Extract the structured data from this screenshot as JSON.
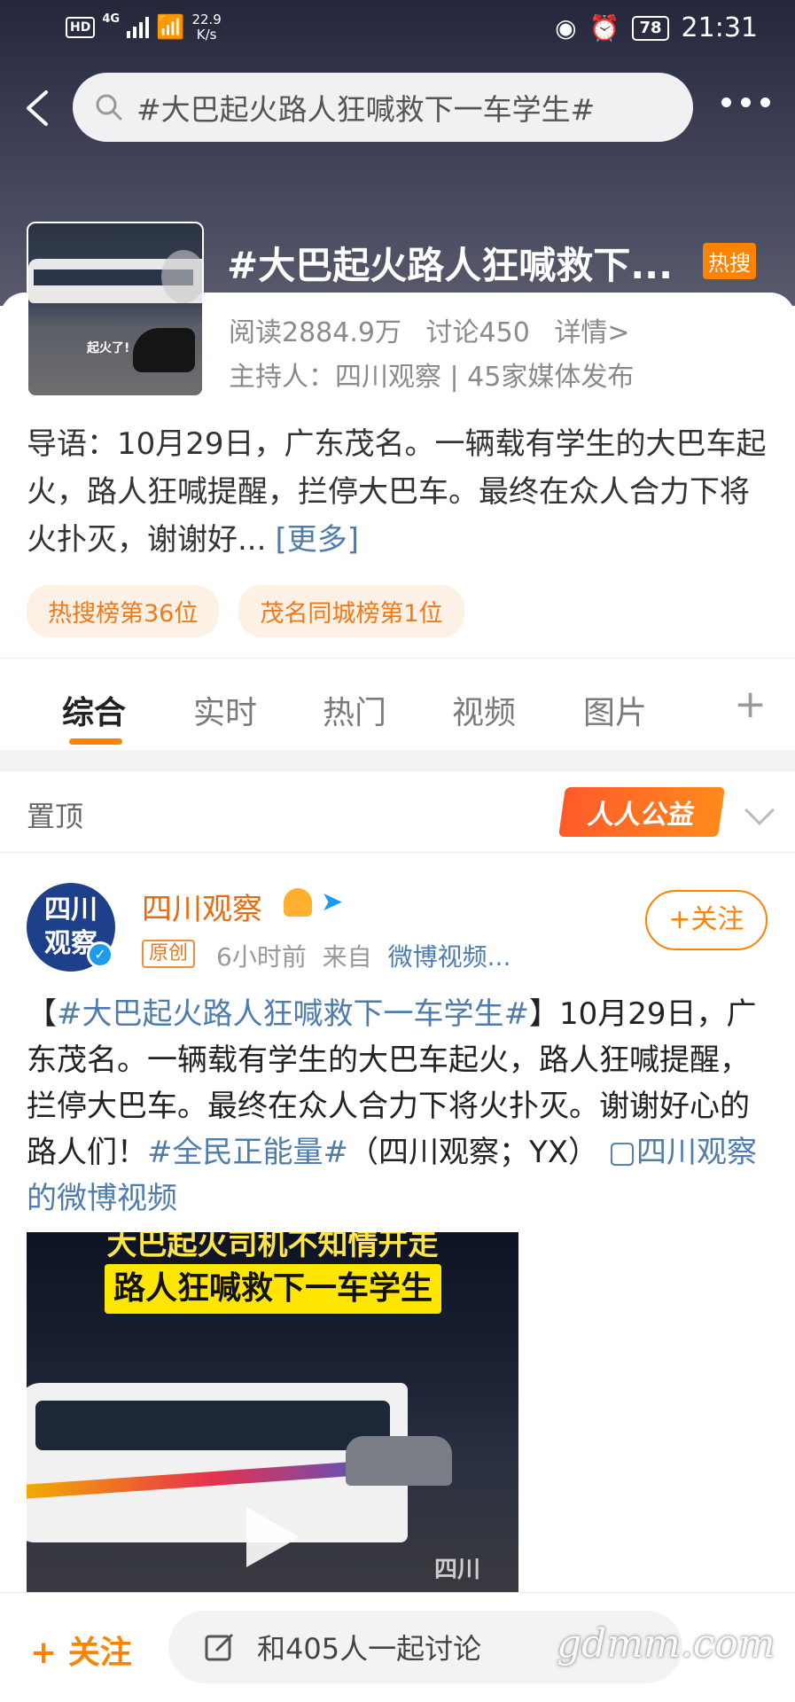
{
  "status_bar": {
    "hd": "HD",
    "net": "4G",
    "speed_value": "22.9",
    "speed_unit": "K/s",
    "battery": "78",
    "time": "21:31"
  },
  "search": {
    "query": "#大巴起火路人狂喊救下一车学生#"
  },
  "topic": {
    "title": "#大巴起火路人狂喊救下...",
    "hot_badge": "热搜",
    "reads": "阅读2884.9万",
    "discussions": "讨论450",
    "details": "详情>",
    "host": "主持人：四川观察 | 45家媒体发布",
    "thumb_caption": "起火了!",
    "intro": "导语：10月29日，广东茂名。一辆载有学生的大巴车起火，路人狂喊提醒，拦停大巴车。最终在众人合力下将火扑灭，谢谢好...",
    "intro_more": "[更多]",
    "tags": [
      "热搜榜第36位",
      "茂名同城榜第1位"
    ]
  },
  "tabs": {
    "items": [
      "综合",
      "实时",
      "热门",
      "视频",
      "图片"
    ],
    "active": 0
  },
  "pinned": {
    "label": "置顶",
    "charity": "人人公益"
  },
  "post": {
    "avatar_line1": "四川",
    "avatar_line2": "观察",
    "author": "四川观察",
    "original": "原创",
    "time": "6小时前",
    "from": "来自",
    "source": "微博视频...",
    "follow": "+关注",
    "text_hashtag": "#大巴起火路人狂喊救下一车学生#",
    "text_body": "10月29日，广东茂名。一辆载有学生的大巴车起火，路人狂喊提醒，拦停大巴车。最终在众人合力下将火扑灭。谢谢好心的路人们！",
    "text_hashtag2": "#全民正能量#",
    "text_tail": "（四川观察；YX）",
    "video_link": "四川观察的微博视频",
    "video_caption1": "大巴起火司机不知情开走",
    "video_caption2": "路人狂喊救下一车学生",
    "video_watermark": "四川"
  },
  "bottom": {
    "follow": "+ 关注",
    "discuss": "和405人一起讨论",
    "watermark": "gdmm.com"
  },
  "colors": {
    "accent": "#ff8200",
    "link": "#4e7cad",
    "hero_bg": "#3a3c52"
  }
}
